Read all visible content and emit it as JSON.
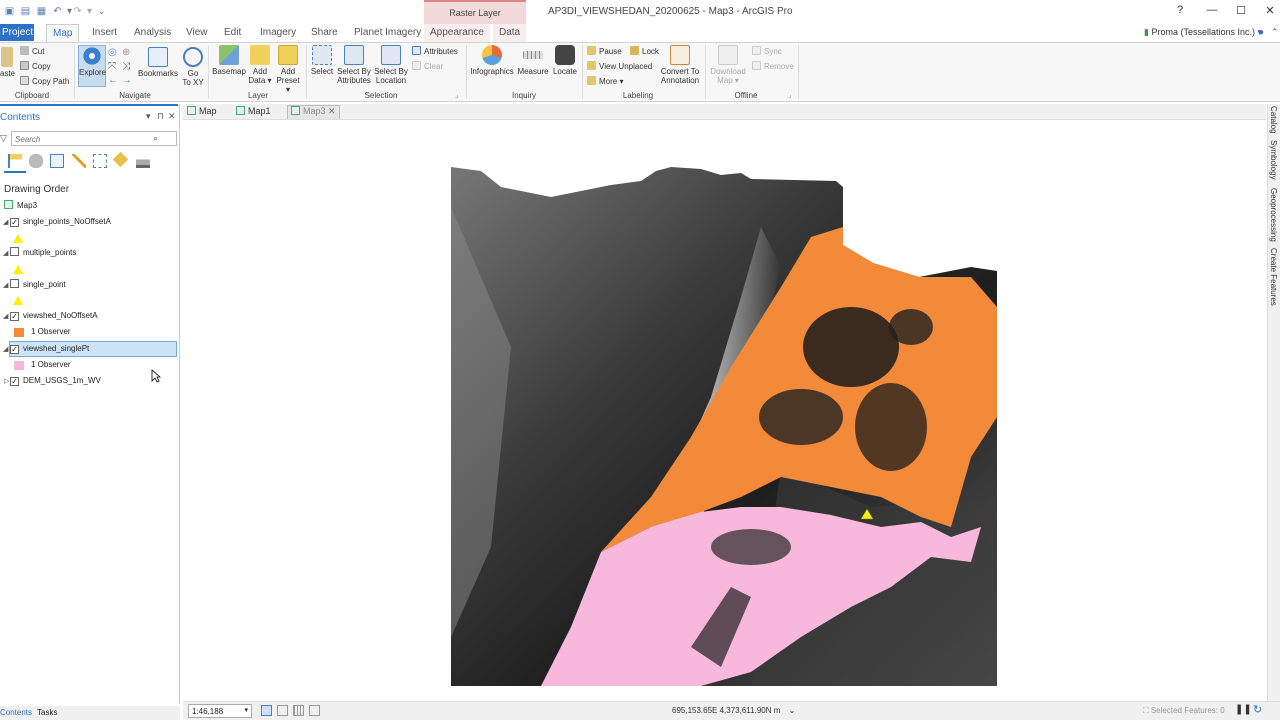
{
  "window": {
    "title": "AP3DI_VIEWSHEDAN_20200625 - Map3 - ArcGIS Pro",
    "context_tab_header": "Raster Layer",
    "help": "?",
    "minimize": "—",
    "maximize": "☐",
    "close": "✕"
  },
  "tabs": [
    {
      "label": "Project"
    },
    {
      "label": "Map"
    },
    {
      "label": "Insert"
    },
    {
      "label": "Analysis"
    },
    {
      "label": "View"
    },
    {
      "label": "Edit"
    },
    {
      "label": "Imagery"
    },
    {
      "label": "Share"
    },
    {
      "label": "Planet Imagery"
    },
    {
      "label": "Appearance"
    },
    {
      "label": "Data"
    }
  ],
  "user": "Proma (Tessellations Inc.) ▾",
  "ribbon": {
    "clipboard": {
      "label": "Clipboard",
      "paste": "aste",
      "cut": "Cut",
      "copy": "Copy",
      "copy_path": "Copy Path"
    },
    "navigate": {
      "label": "Navigate",
      "explore": "Explore",
      "bookmarks": "Bookmarks",
      "goto": "Go\nTo XY",
      "goto_1": "Go",
      "goto_2": "To XY"
    },
    "layer": {
      "label": "Layer",
      "basemap": "Basemap",
      "add_data_1": "Add",
      "add_data_2": "Data ▾",
      "add_preset_1": "Add",
      "add_preset_2": "Preset ▾"
    },
    "selection": {
      "label": "Selection",
      "select": "Select",
      "select_by_attr_1": "Select By",
      "select_by_attr_2": "Attributes",
      "select_by_loc_1": "Select By",
      "select_by_loc_2": "Location",
      "attributes": "Attributes",
      "clear": "Clear"
    },
    "inquiry": {
      "label": "Inquiry",
      "infographics": "Infographics",
      "measure": "Measure",
      "locate": "Locate"
    },
    "labeling": {
      "label": "Labeling",
      "pause": "Pause",
      "lock": "Lock",
      "view_unplaced": "View Unplaced",
      "more": "More ▾",
      "convert_1": "Convert To",
      "convert_2": "Annotation"
    },
    "offline": {
      "label": "Offline",
      "download_1": "Download",
      "download_2": "Map ▾",
      "sync": "Sync",
      "remove": "Remove"
    }
  },
  "contents": {
    "title": "Contents",
    "pin": "▾ ⊓ ✕",
    "search_placeholder": "Search",
    "drawing_order": "Drawing Order",
    "map_name": "Map3",
    "layers": [
      {
        "name": "single_points_NoOffsetA",
        "checked": true
      },
      {
        "name": "multiple_points",
        "checked": false
      },
      {
        "name": "single_point",
        "checked": false
      },
      {
        "name": "viewshed_NoOffsetA",
        "checked": true,
        "legend": "1 Observer",
        "color": "#f28a3a"
      },
      {
        "name": "viewshed_singlePt",
        "checked": true,
        "legend": "1 Observer",
        "color": "#f7b8dc"
      },
      {
        "name": "DEM_USGS_1m_WV",
        "checked": true
      }
    ],
    "bottom_tabs": {
      "contents": "Contents",
      "tasks": "Tasks"
    }
  },
  "map_tabs": [
    {
      "label": "Map"
    },
    {
      "label": "Map1"
    },
    {
      "label": "Map3"
    }
  ],
  "right_dock": [
    "Catalog",
    "Symbology",
    "Geoprocessing",
    "Create Features"
  ],
  "status": {
    "scale": "1:46,188",
    "coordinates": "695,153.65E 4,373,611.90N m",
    "selected_features": "Selected Features: 0"
  },
  "colors": {
    "accent": "#2c72c7",
    "viewshed_orange": "#f28a3a",
    "viewshed_pink": "#f7b8dc",
    "observer_point": "#ffee00"
  }
}
